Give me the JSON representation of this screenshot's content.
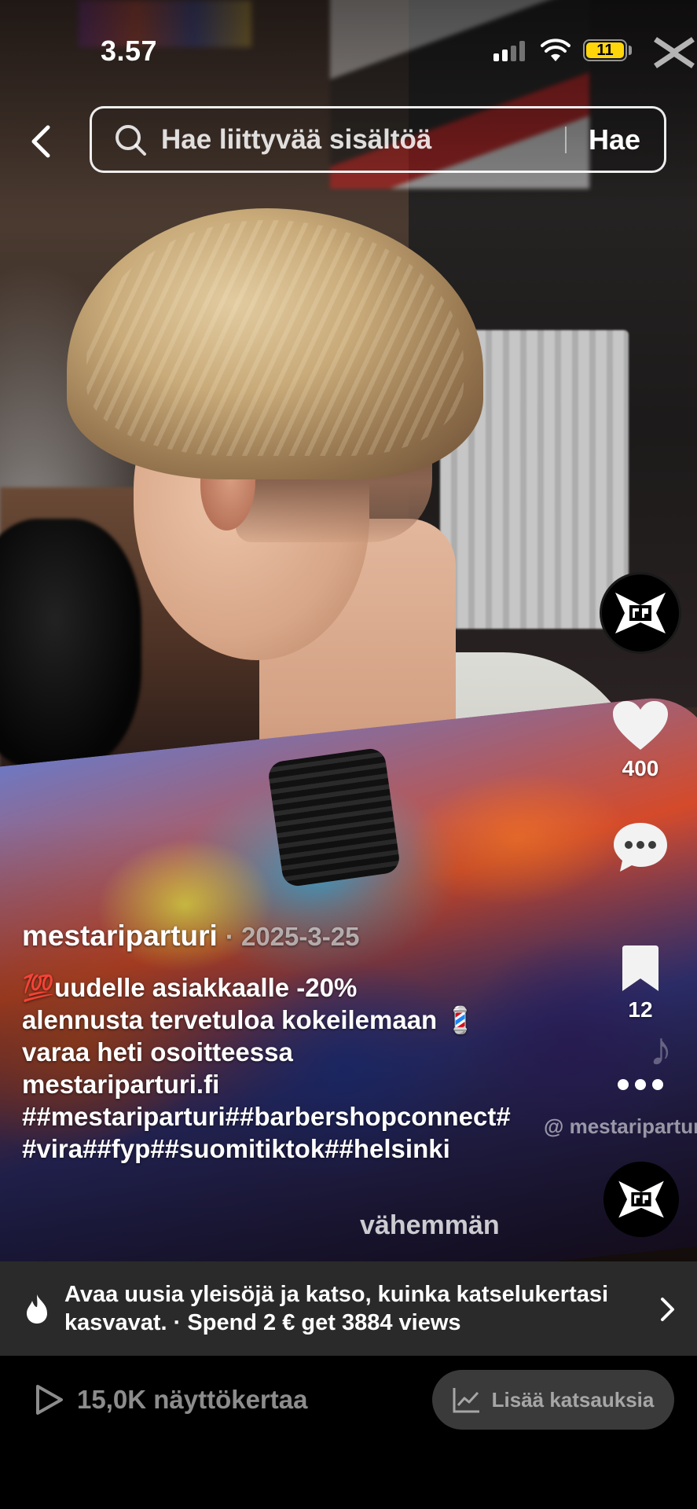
{
  "status_bar": {
    "time": "3.57",
    "battery_level": "11",
    "signal_bars": 2,
    "battery_color": "#ffd60a"
  },
  "search": {
    "placeholder": "Hae liittyvää sisältöä",
    "button_label": "Hae"
  },
  "actions": {
    "likes": "400",
    "bookmarks": "12"
  },
  "watermark": "@ mestariparturi",
  "post": {
    "author": "mestariparturi",
    "date": "· 2025-3-25",
    "caption_lines": [
      "💯uudelle asiakkaalle -20%",
      "alennusta tervetuloa kokeilemaan 💈",
      "varaa heti osoitteessa",
      "mestariparturi.fi",
      "##mestariparturi##barbershopconnect##vira##fyp##suomitiktok##helsinki"
    ],
    "collapse_label": "vähemmän"
  },
  "promo": {
    "text": "Avaa uusia yleisöjä ja katso, kuinka katselukertasi kasvavat. · Spend 2 € get 3884 views"
  },
  "footer": {
    "views": "15,0K näyttökertaa",
    "insights_label": "Lisää katsauksia"
  }
}
